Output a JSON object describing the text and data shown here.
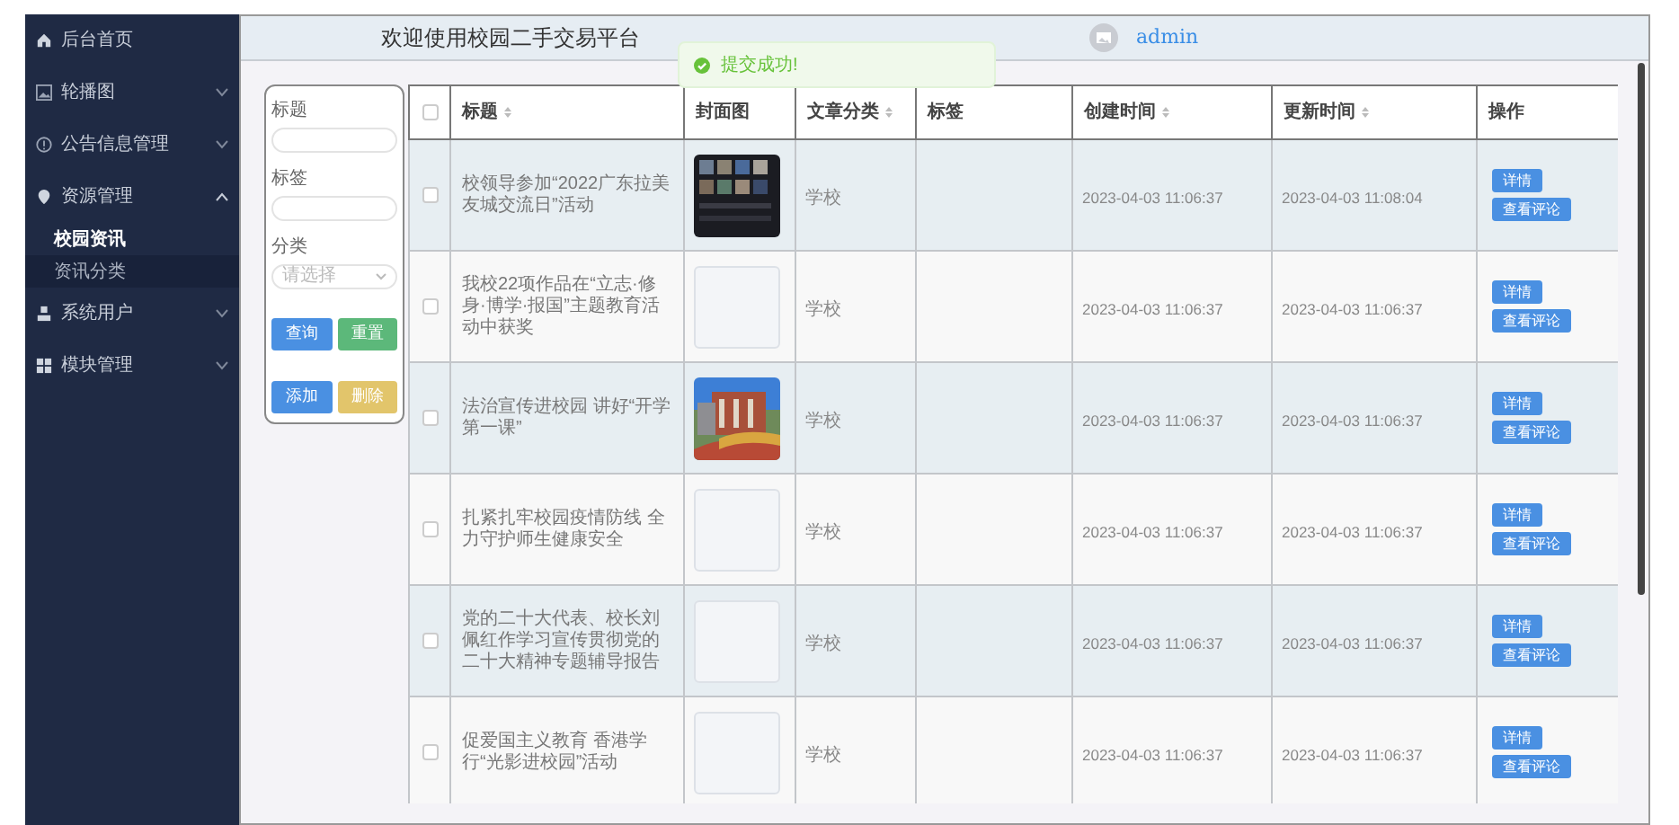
{
  "sidebar": {
    "items": [
      {
        "label": "后台首页"
      },
      {
        "label": "轮播图",
        "expanded": false
      },
      {
        "label": "公告信息管理",
        "expanded": false
      },
      {
        "label": "资源管理",
        "expanded": true,
        "children": [
          {
            "label": "校园资讯",
            "selected": true
          },
          {
            "label": "资讯分类",
            "selected": false
          }
        ]
      },
      {
        "label": "系统用户",
        "expanded": false
      },
      {
        "label": "模块管理",
        "expanded": false
      }
    ]
  },
  "header": {
    "title": "欢迎使用校园二手交易平台",
    "user": "admin"
  },
  "toast": {
    "message": "提交成功!"
  },
  "search_form": {
    "fields": [
      {
        "label": "标题",
        "kind": "input"
      },
      {
        "label": "标签",
        "kind": "input"
      },
      {
        "label": "分类",
        "kind": "select",
        "placeholder": "请选择"
      }
    ],
    "buttons": [
      {
        "label": "查询",
        "color": "#4a90e2"
      },
      {
        "label": "重置",
        "color": "#5cb87a"
      },
      {
        "label": "添加",
        "color": "#4a90e2"
      },
      {
        "label": "删除",
        "color": "#e2c56b"
      }
    ]
  },
  "table": {
    "all_checked": false,
    "columns": [
      {
        "label": "标题",
        "sortable": true
      },
      {
        "label": "封面图",
        "sortable": false
      },
      {
        "label": "文章分类",
        "sortable": true
      },
      {
        "label": "标签",
        "sortable": false
      },
      {
        "label": "创建时间",
        "sortable": true
      },
      {
        "label": "更新时间",
        "sortable": true
      },
      {
        "label": "操作",
        "sortable": false
      }
    ],
    "rows": [
      {
        "checked": false,
        "title": "校领导参加“2022广东拉美友城交流日”活动",
        "cover": {
          "kind": "picture"
        },
        "category": "学校",
        "created": "2023-04-03 11:06:37",
        "updated": "2023-04-03 11:08:04",
        "actions": [
          "详情",
          "查看评论"
        ]
      },
      {
        "checked": false,
        "title": "我校22项作品在“立志·修身·博学·报国”主题教育活动中获奖",
        "category": "学校",
        "created": "2023-04-03 11:06:37",
        "updated": "2023-04-03 11:06:37",
        "actions": [
          "详情",
          "查看评论"
        ]
      },
      {
        "checked": false,
        "title": "法治宣传进校园 讲好“开学第一课”",
        "cover": {
          "kind": "picture"
        },
        "category": "学校",
        "created": "2023-04-03 11:06:37",
        "updated": "2023-04-03 11:06:37",
        "actions": [
          "详情",
          "查看评论"
        ]
      },
      {
        "checked": false,
        "title": "扎紧扎牢校园疫情防线 全力守护师生健康安全",
        "category": "学校",
        "created": "2023-04-03 11:06:37",
        "updated": "2023-04-03 11:06:37",
        "actions": [
          "详情",
          "查看评论"
        ]
      },
      {
        "checked": false,
        "title": "党的二十大代表、校长刘佩红作学习宣传贯彻党的二十大精神专题辅导报告",
        "category": "学校",
        "created": "2023-04-03 11:06:37",
        "updated": "2023-04-03 11:06:37",
        "actions": [
          "详情",
          "查看评论"
        ]
      },
      {
        "checked": false,
        "title": "促爱国主义教育 香港学行“光影进校园”活动",
        "category": "学校",
        "created": "2023-04-03 11:06:37",
        "updated": "2023-04-03 11:06:37",
        "actions": [
          "详情",
          "查看评论"
        ]
      }
    ]
  }
}
